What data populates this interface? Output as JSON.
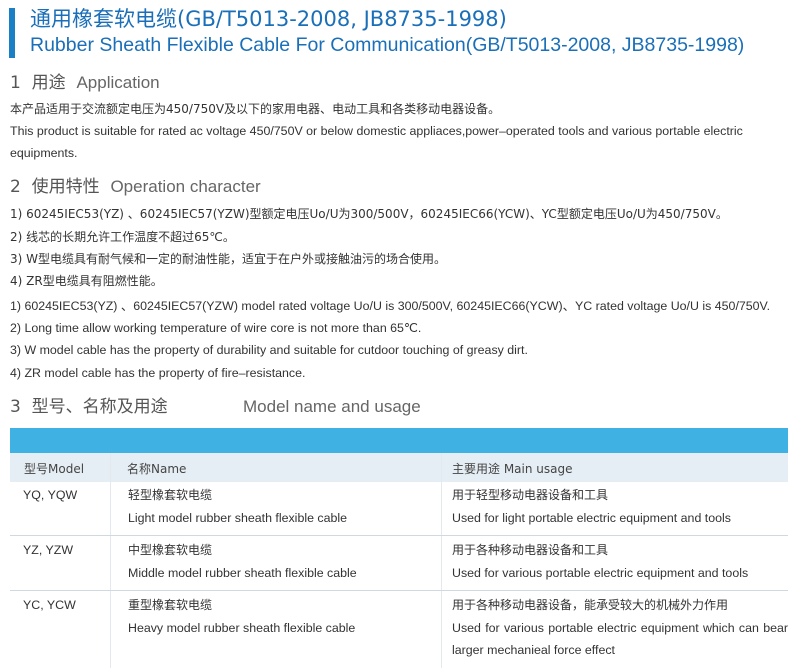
{
  "header": {
    "title_cn": "通用橡套软电缆(GB/T5013-2008, JB8735-1998)",
    "title_en": "Rubber Sheath Flexible Cable For Communication(GB/T5013-2008, JB8735-1998)"
  },
  "sections": {
    "application": {
      "number": "1",
      "title_cn": "用途",
      "title_en": "Application",
      "text_cn": "本产品适用于交流额定电压为450/750V及以下的家用电器、电动工具和各类移动电器设备。",
      "text_en": "This product is suitable for rated ac voltage 450/750V or below domestic appliaces,power–operated tools and various portable electric equipments."
    },
    "operation": {
      "number": "2",
      "title_cn": "使用特性",
      "title_en": "Operation character",
      "items_cn": [
        "1) 60245IEC53(YZ) 、60245IEC57(YZW)型额定电压Uo/U为300/500V，60245IEC66(YCW)、YC型额定电压Uo/U为450/750V。",
        "2) 线芯的长期允许工作温度不超过65℃。",
        "3) W型电缆具有耐气候和一定的耐油性能，适宜于在户外或接触油污的场合使用。",
        "4) ZR型电缆具有阻燃性能。"
      ],
      "items_en": [
        "1) 60245IEC53(YZ) 、60245IEC57(YZW) model rated voltage Uo/U is 300/500V, 60245IEC66(YCW)、YC rated voltage Uo/U is 450/750V.",
        "2) Long time allow working temperature of wire core is not more than 65℃.",
        "3) W model cable has the property of durability and suitable for cutdoor touching of greasy dirt.",
        "4) ZR model cable has the property of fire–resistance."
      ]
    },
    "models": {
      "number": "3",
      "title_cn": "型号、名称及用途",
      "title_en": "Model name and usage",
      "columns": [
        "型号Model",
        "名称Name",
        "主要用途  Main usage"
      ],
      "rows": [
        {
          "model": "YQ, YQW",
          "name_cn": "轻型橡套软电缆",
          "name_en": "Light model rubber sheath flexible cable",
          "usage_cn": "用于轻型移动电器设备和工具",
          "usage_en": "Used for light portable electric equipment and tools"
        },
        {
          "model": "YZ, YZW",
          "name_cn": "中型橡套软电缆",
          "name_en": "Middle model rubber sheath flexible cable",
          "usage_cn": "用于各种移动电器设备和工具",
          "usage_en": "Used for various portable electric equipment and tools"
        },
        {
          "model": "YC, YCW",
          "name_cn": "重型橡套软电缆",
          "name_en": "Heavy model rubber sheath flexible cable",
          "usage_cn": "用于各种移动电器设备，能承受较大的机械外力作用",
          "usage_en": "Used for various portable electric equipment which can bear larger mechanieal force effect"
        }
      ]
    }
  },
  "colors": {
    "title": "#1a6fb8",
    "accent_bar": "#1a7fc4",
    "table_band": "#3fb1e3",
    "table_header": "#e6eef5"
  }
}
